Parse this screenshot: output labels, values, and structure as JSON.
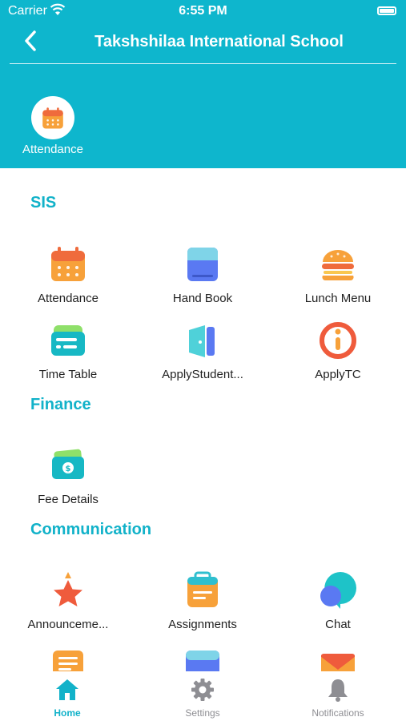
{
  "status_bar": {
    "carrier": "Carrier",
    "time": "6:55 PM"
  },
  "nav": {
    "title": "Takshshilaa International School"
  },
  "quick_access": {
    "label": "Attendance"
  },
  "sections": {
    "sis": {
      "title": "SIS",
      "items": [
        "Attendance",
        "Hand Book",
        "Lunch Menu",
        "Time Table",
        "ApplyStudent...",
        "ApplyTC"
      ]
    },
    "finance": {
      "title": "Finance",
      "items": [
        "Fee Details"
      ]
    },
    "communication": {
      "title": "Communication",
      "items": [
        "Announceme...",
        "Assignments",
        "Chat"
      ]
    }
  },
  "tabs": {
    "home": "Home",
    "settings": "Settings",
    "notifications": "Notifications"
  },
  "colors": {
    "accent": "#0eb6cd",
    "active_tab": "#12b2c9",
    "inactive_tab": "#8e8e93"
  }
}
